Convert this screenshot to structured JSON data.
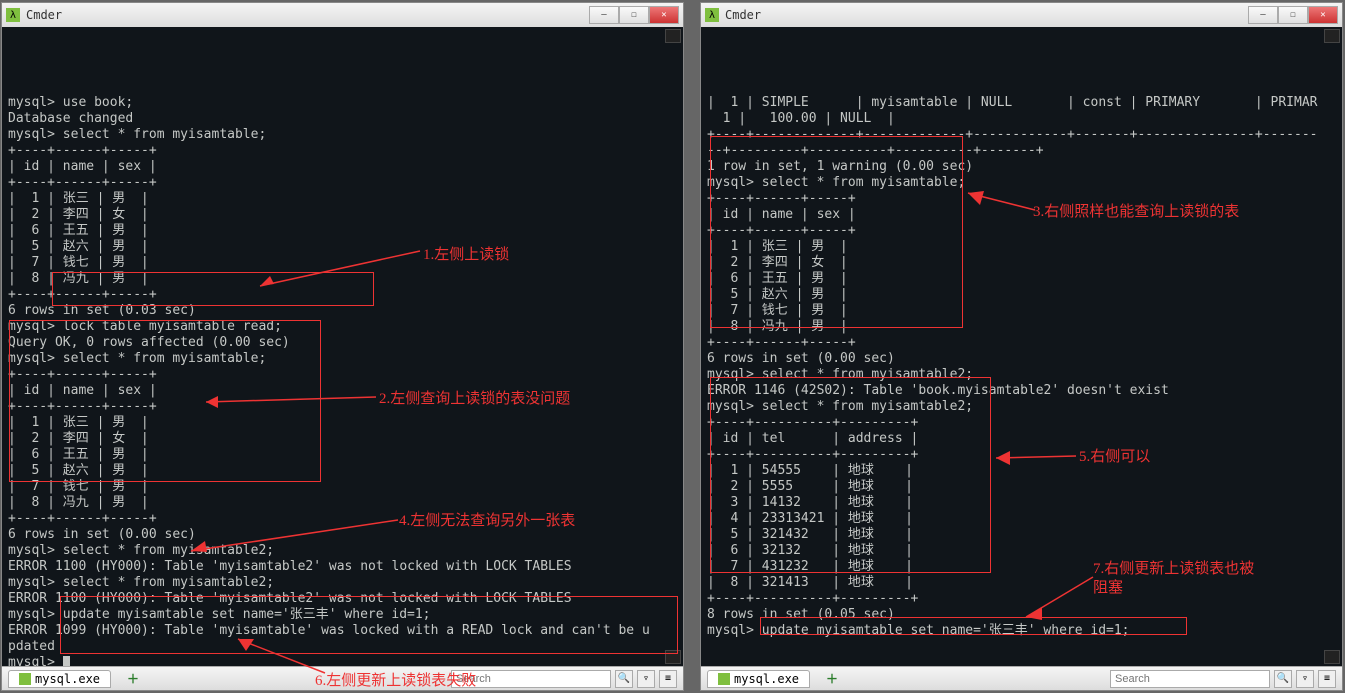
{
  "window_title": "Cmder",
  "tab_label": "mysql.exe",
  "search_placeholder": "Search",
  "left": {
    "lines": [
      "mysql> use book;",
      "Database changed",
      "mysql> select * from myisamtable;",
      "+----+------+-----+",
      "| id | name | sex |",
      "+----+------+-----+",
      "|  1 | 张三 | 男  |",
      "|  2 | 李四 | 女  |",
      "|  6 | 王五 | 男  |",
      "|  5 | 赵六 | 男  |",
      "|  7 | 钱七 | 男  |",
      "|  8 | 冯九 | 男  |",
      "+----+------+-----+",
      "6 rows in set (0.03 sec)",
      "",
      "mysql> lock table myisamtable read;",
      "Query OK, 0 rows affected (0.00 sec)",
      "",
      "mysql> select * from myisamtable;",
      "+----+------+-----+",
      "| id | name | sex |",
      "+----+------+-----+",
      "|  1 | 张三 | 男  |",
      "|  2 | 李四 | 女  |",
      "|  6 | 王五 | 男  |",
      "|  5 | 赵六 | 男  |",
      "|  7 | 钱七 | 男  |",
      "|  8 | 冯九 | 男  |",
      "+----+------+-----+",
      "6 rows in set (0.00 sec)",
      "",
      "mysql> select * from myisamtable2;",
      "ERROR 1100 (HY000): Table 'myisamtable2' was not locked with LOCK TABLES",
      "mysql> select * from myisamtable2;",
      "ERROR 1100 (HY000): Table 'myisamtable2' was not locked with LOCK TABLES",
      "mysql> update myisamtable set name='张三丰' where id=1;",
      "ERROR 1099 (HY000): Table 'myisamtable' was locked with a READ lock and can't be u",
      "pdated",
      "mysql> "
    ]
  },
  "right": {
    "lines": [
      "|  1 | SIMPLE      | myisamtable | NULL       | const | PRIMARY       | PRIMAR",
      "  1 |   100.00 | NULL  |",
      "+----+-------------+-------------+------------+-------+---------------+-------",
      "--+---------+----------+----------+-------+",
      "1 row in set, 1 warning (0.00 sec)",
      "",
      "mysql> select * from myisamtable;",
      "+----+------+-----+",
      "| id | name | sex |",
      "+----+------+-----+",
      "|  1 | 张三 | 男  |",
      "|  2 | 李四 | 女  |",
      "|  6 | 王五 | 男  |",
      "|  5 | 赵六 | 男  |",
      "|  7 | 钱七 | 男  |",
      "|  8 | 冯九 | 男  |",
      "+----+------+-----+",
      "6 rows in set (0.00 sec)",
      "",
      "mysql> select * from myisamtable2;",
      "ERROR 1146 (42S02): Table 'book.myisamtable2' doesn't exist",
      "mysql> select * from myisamtable2;",
      "+----+----------+---------+",
      "| id | tel      | address |",
      "+----+----------+---------+",
      "|  1 | 54555    | 地球    |",
      "|  2 | 5555     | 地球    |",
      "|  3 | 14132    | 地球    |",
      "|  4 | 23313421 | 地球    |",
      "|  5 | 321432   | 地球    |",
      "|  6 | 32132    | 地球    |",
      "|  7 | 431232   | 地球    |",
      "|  8 | 321413   | 地球    |",
      "+----+----------+---------+",
      "8 rows in set (0.05 sec)",
      "",
      "mysql> update myisamtable set name='张三丰' where id=1;"
    ]
  },
  "annotations": {
    "a1": "1.左侧上读锁",
    "a2": "2.左侧查询上读锁的表没问题",
    "a3": "3.右侧照样也能查询上读锁的表",
    "a4": "4.左侧无法查询另外一张表",
    "a5": "5.右侧可以",
    "a6": "6.左侧更新上读锁表失败",
    "a7": "7.右侧更新上读锁表也被",
    "a7b": "阻塞"
  },
  "chart_data": [
    {
      "type": "table",
      "title": "myisamtable",
      "columns": [
        "id",
        "name",
        "sex"
      ],
      "rows": [
        [
          1,
          "张三",
          "男"
        ],
        [
          2,
          "李四",
          "女"
        ],
        [
          6,
          "王五",
          "男"
        ],
        [
          5,
          "赵六",
          "男"
        ],
        [
          7,
          "钱七",
          "男"
        ],
        [
          8,
          "冯九",
          "男"
        ]
      ]
    },
    {
      "type": "table",
      "title": "myisamtable2",
      "columns": [
        "id",
        "tel",
        "address"
      ],
      "rows": [
        [
          1,
          "54555",
          "地球"
        ],
        [
          2,
          "5555",
          "地球"
        ],
        [
          3,
          "14132",
          "地球"
        ],
        [
          4,
          "23313421",
          "地球"
        ],
        [
          5,
          "321432",
          "地球"
        ],
        [
          6,
          "32132",
          "地球"
        ],
        [
          7,
          "431232",
          "地球"
        ],
        [
          8,
          "321413",
          "地球"
        ]
      ]
    }
  ]
}
